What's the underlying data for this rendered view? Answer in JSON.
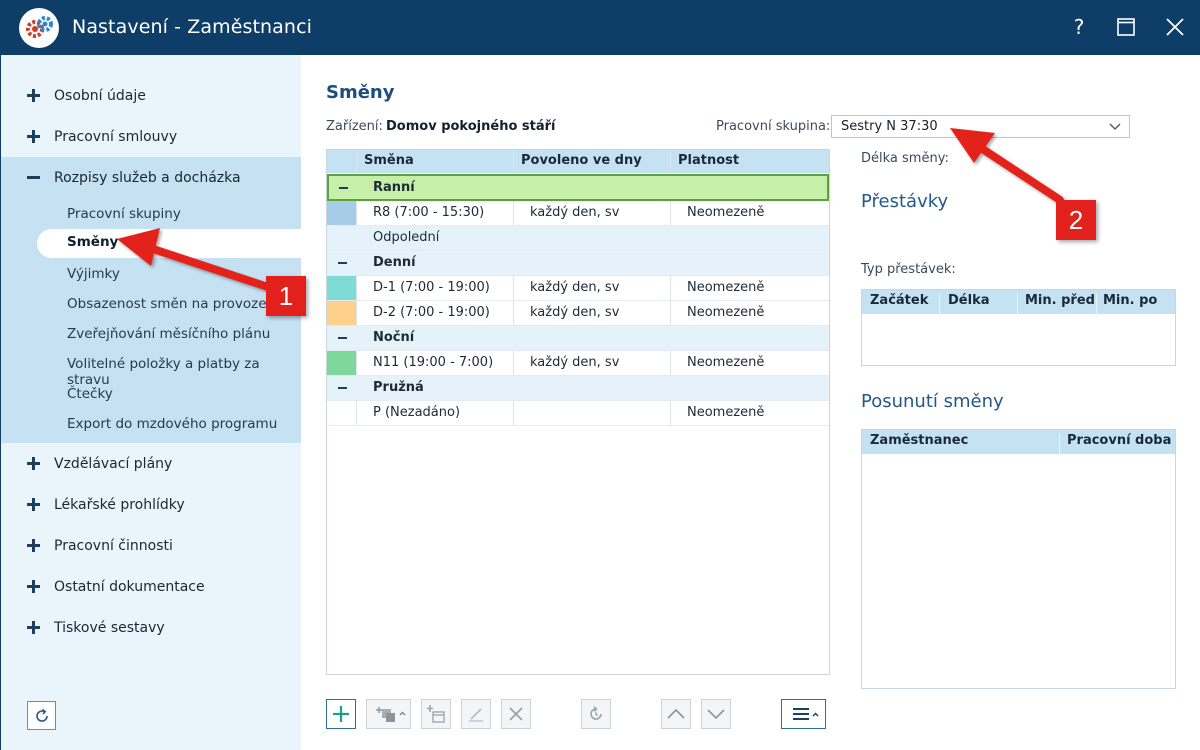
{
  "window": {
    "title": "Nastavení - Zaměstnanci",
    "help_label": "?"
  },
  "sidebar": {
    "top_items": [
      {
        "label": "Osobní údaje",
        "expanded": false
      },
      {
        "label": "Pracovní smlouvy",
        "expanded": false
      },
      {
        "label": "Rozpisy služeb a docházka",
        "expanded": true
      },
      {
        "label": "Vzdělávací plány",
        "expanded": false
      },
      {
        "label": "Lékařské prohlídky",
        "expanded": false
      },
      {
        "label": "Pracovní činnosti",
        "expanded": false
      },
      {
        "label": "Ostatní dokumentace",
        "expanded": false
      },
      {
        "label": "Tiskové sestavy",
        "expanded": false
      }
    ],
    "sub_items": [
      {
        "label": "Pracovní skupiny"
      },
      {
        "label": "Směny",
        "active": true
      },
      {
        "label": "Výjimky"
      },
      {
        "label": "Obsazenost směn na provozech"
      },
      {
        "label": "Zveřejňování měsíčního plánu"
      },
      {
        "label": "Volitelné položky a platby za stravu"
      },
      {
        "label": "Čtečky"
      },
      {
        "label": "Export do mzdového programu"
      }
    ]
  },
  "main": {
    "title": "Směny",
    "facility_label": "Zařízení:",
    "facility_value": "Domov pokojného stáří",
    "group_label": "Pracovní skupina:",
    "group_value": "Sestry N 37:30",
    "grid": {
      "columns": [
        "Směna",
        "Povoleno ve dny",
        "Platnost"
      ],
      "rows": [
        {
          "type": "group",
          "name": "Ranní",
          "selected": true
        },
        {
          "type": "item",
          "name": "R8 (7:00 - 15:30)",
          "days": "každý den, sv",
          "validity": "Neomezeně",
          "color": "#a7cce6"
        },
        {
          "type": "plain",
          "name": "Odpolední"
        },
        {
          "type": "group",
          "name": "Denní"
        },
        {
          "type": "item",
          "name": "D-1 (7:00 - 19:00)",
          "days": "každý den, sv",
          "validity": "Neomezeně",
          "color": "#7fdcd4"
        },
        {
          "type": "item",
          "name": "D-2 (7:00 - 19:00)",
          "days": "každý den, sv",
          "validity": "Neomezeně",
          "color": "#ffd089"
        },
        {
          "type": "group",
          "name": "Noční"
        },
        {
          "type": "item",
          "name": "N11 (19:00 - 7:00)",
          "days": "každý den, sv",
          "validity": "Neomezeně",
          "color": "#7ed89b"
        },
        {
          "type": "group",
          "name": "Pružná"
        },
        {
          "type": "item",
          "name": "P (Nezadáno)",
          "days": "",
          "validity": "Neomezeně",
          "color": ""
        }
      ]
    },
    "toolbar": [
      "add",
      "copy",
      "add-dated",
      "edit",
      "delete",
      "restore",
      "move-up",
      "move-down",
      "menu"
    ]
  },
  "right_panel": {
    "shift_length_label": "Délka směny:",
    "breaks_title": "Přestávky",
    "break_type_label": "Typ přestávek:",
    "breaks_columns": [
      "Začátek",
      "Délka",
      "Min. před",
      "Min. po"
    ],
    "shift_offset_title": "Posunutí směny",
    "offset_columns": [
      "Zaměstnanec",
      "Pracovní doba"
    ]
  },
  "annotations": [
    {
      "label": "1"
    },
    {
      "label": "2"
    }
  ],
  "colors": {
    "titlebar": "#0e3e68",
    "sidebar": "#eaf4fb",
    "sidebar_expanded": "#c6e1f2",
    "header": "#c5e2f3",
    "selected_group": "#c6efaa",
    "annotation": "#e3211c",
    "accent_heading": "#23598a"
  }
}
